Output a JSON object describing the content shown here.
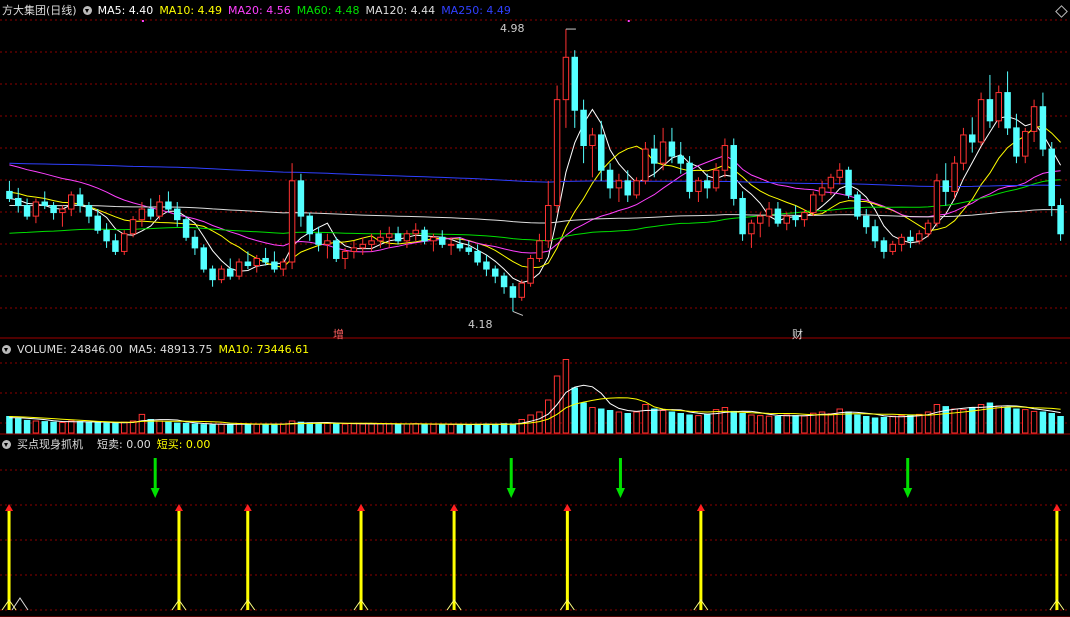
{
  "main_panel": {
    "title": "方大集团(日线)",
    "indicators": [
      {
        "label": "MA5: 4.40",
        "color": "#ffffff"
      },
      {
        "label": "MA10: 4.49",
        "color": "#ffff00"
      },
      {
        "label": "MA20: 4.56",
        "color": "#ff40ff"
      },
      {
        "label": "MA60: 4.48",
        "color": "#00e000"
      },
      {
        "label": "MA120: 4.44",
        "color": "#dddddd"
      },
      {
        "label": "MA250: 4.49",
        "color": "#3040ff"
      }
    ],
    "high_label": "4.98",
    "low_label": "4.18",
    "marker_left": "增",
    "marker_right": "财"
  },
  "volume_panel": {
    "label": "VOLUME: 24846.00",
    "ma5": "MA5: 48913.75",
    "ma10": "MA10: 73446.61"
  },
  "signal_panel": {
    "title": "买点现身抓机",
    "short_sell": "短卖: 0.00",
    "short_buy": "短买: 0.00"
  },
  "colors": {
    "up": "#ff3232",
    "down": "#54ffff",
    "grid": "#8b0000",
    "bg": "#000000"
  },
  "chart_data": {
    "type": "candlestick",
    "candles": [
      [
        4.52,
        4.55,
        4.49,
        4.5
      ],
      [
        4.5,
        4.53,
        4.46,
        4.48
      ],
      [
        4.48,
        4.5,
        4.44,
        4.45
      ],
      [
        4.45,
        4.5,
        4.43,
        4.49
      ],
      [
        4.49,
        4.52,
        4.47,
        4.48
      ],
      [
        4.48,
        4.49,
        4.44,
        4.46
      ],
      [
        4.46,
        4.48,
        4.42,
        4.47
      ],
      [
        4.47,
        4.52,
        4.45,
        4.51
      ],
      [
        4.51,
        4.53,
        4.46,
        4.48
      ],
      [
        4.48,
        4.49,
        4.43,
        4.45
      ],
      [
        4.45,
        4.47,
        4.4,
        4.41
      ],
      [
        4.41,
        4.43,
        4.36,
        4.38
      ],
      [
        4.38,
        4.4,
        4.34,
        4.35
      ],
      [
        4.35,
        4.41,
        4.34,
        4.4
      ],
      [
        4.4,
        4.45,
        4.39,
        4.44
      ],
      [
        4.44,
        4.49,
        4.42,
        4.47
      ],
      [
        4.47,
        4.5,
        4.44,
        4.45
      ],
      [
        4.45,
        4.51,
        4.44,
        4.49
      ],
      [
        4.49,
        4.52,
        4.46,
        4.47
      ],
      [
        4.47,
        4.49,
        4.42,
        4.44
      ],
      [
        4.44,
        4.45,
        4.38,
        4.39
      ],
      [
        4.39,
        4.41,
        4.34,
        4.36
      ],
      [
        4.36,
        4.37,
        4.29,
        4.3
      ],
      [
        4.3,
        4.31,
        4.25,
        4.27
      ],
      [
        4.27,
        4.31,
        4.26,
        4.3
      ],
      [
        4.3,
        4.33,
        4.27,
        4.28
      ],
      [
        4.28,
        4.33,
        4.27,
        4.32
      ],
      [
        4.32,
        4.35,
        4.3,
        4.31
      ],
      [
        4.31,
        4.34,
        4.29,
        4.33
      ],
      [
        4.33,
        4.36,
        4.31,
        4.32
      ],
      [
        4.32,
        4.35,
        4.29,
        4.3
      ],
      [
        4.3,
        4.33,
        4.28,
        4.32
      ],
      [
        4.32,
        4.6,
        4.3,
        4.55
      ],
      [
        4.55,
        4.57,
        4.42,
        4.45
      ],
      [
        4.45,
        4.46,
        4.38,
        4.4
      ],
      [
        4.4,
        4.42,
        4.35,
        4.37
      ],
      [
        4.37,
        4.4,
        4.33,
        4.38
      ],
      [
        4.38,
        4.39,
        4.32,
        4.33
      ],
      [
        4.33,
        4.36,
        4.3,
        4.35
      ],
      [
        4.35,
        4.38,
        4.33,
        4.36
      ],
      [
        4.36,
        4.39,
        4.34,
        4.37
      ],
      [
        4.37,
        4.4,
        4.35,
        4.38
      ],
      [
        4.38,
        4.41,
        4.36,
        4.39
      ],
      [
        4.39,
        4.42,
        4.36,
        4.4
      ],
      [
        4.4,
        4.42,
        4.37,
        4.38
      ],
      [
        4.38,
        4.41,
        4.36,
        4.4
      ],
      [
        4.4,
        4.43,
        4.38,
        4.41
      ],
      [
        4.41,
        4.42,
        4.37,
        4.38
      ],
      [
        4.38,
        4.4,
        4.35,
        4.39
      ],
      [
        4.39,
        4.41,
        4.36,
        4.37
      ],
      [
        4.37,
        4.39,
        4.34,
        4.37
      ],
      [
        4.37,
        4.39,
        4.35,
        4.36
      ],
      [
        4.36,
        4.38,
        4.34,
        4.35
      ],
      [
        4.35,
        4.37,
        4.31,
        4.32
      ],
      [
        4.32,
        4.34,
        4.28,
        4.3
      ],
      [
        4.3,
        4.31,
        4.26,
        4.28
      ],
      [
        4.28,
        4.29,
        4.23,
        4.25
      ],
      [
        4.25,
        4.26,
        4.18,
        4.22
      ],
      [
        4.22,
        4.27,
        4.21,
        4.26
      ],
      [
        4.26,
        4.34,
        4.25,
        4.33
      ],
      [
        4.33,
        4.4,
        4.32,
        4.38
      ],
      [
        4.38,
        4.55,
        4.36,
        4.48
      ],
      [
        4.48,
        4.82,
        4.46,
        4.78
      ],
      [
        4.78,
        4.98,
        4.7,
        4.9
      ],
      [
        4.9,
        4.92,
        4.7,
        4.75
      ],
      [
        4.75,
        4.78,
        4.6,
        4.65
      ],
      [
        4.65,
        4.7,
        4.56,
        4.68
      ],
      [
        4.68,
        4.72,
        4.55,
        4.58
      ],
      [
        4.58,
        4.6,
        4.5,
        4.53
      ],
      [
        4.53,
        4.57,
        4.49,
        4.55
      ],
      [
        4.55,
        4.58,
        4.49,
        4.51
      ],
      [
        4.51,
        4.56,
        4.5,
        4.55
      ],
      [
        4.55,
        4.66,
        4.54,
        4.64
      ],
      [
        4.64,
        4.68,
        4.56,
        4.6
      ],
      [
        4.6,
        4.7,
        4.58,
        4.66
      ],
      [
        4.66,
        4.7,
        4.6,
        4.62
      ],
      [
        4.62,
        4.66,
        4.57,
        4.6
      ],
      [
        4.6,
        4.62,
        4.5,
        4.52
      ],
      [
        4.52,
        4.56,
        4.49,
        4.55
      ],
      [
        4.55,
        4.57,
        4.5,
        4.53
      ],
      [
        4.53,
        4.6,
        4.52,
        4.58
      ],
      [
        4.58,
        4.67,
        4.56,
        4.65
      ],
      [
        4.65,
        4.67,
        4.48,
        4.5
      ],
      [
        4.5,
        4.52,
        4.38,
        4.4
      ],
      [
        4.4,
        4.44,
        4.36,
        4.43
      ],
      [
        4.43,
        4.46,
        4.39,
        4.45
      ],
      [
        4.45,
        4.49,
        4.42,
        4.47
      ],
      [
        4.47,
        4.49,
        4.42,
        4.43
      ],
      [
        4.43,
        4.46,
        4.41,
        4.45
      ],
      [
        4.45,
        4.48,
        4.42,
        4.44
      ],
      [
        4.44,
        4.47,
        4.42,
        4.46
      ],
      [
        4.46,
        4.52,
        4.45,
        4.51
      ],
      [
        4.51,
        4.55,
        4.49,
        4.53
      ],
      [
        4.53,
        4.57,
        4.51,
        4.56
      ],
      [
        4.56,
        4.6,
        4.54,
        4.58
      ],
      [
        4.58,
        4.59,
        4.5,
        4.51
      ],
      [
        4.51,
        4.52,
        4.44,
        4.45
      ],
      [
        4.45,
        4.47,
        4.4,
        4.42
      ],
      [
        4.42,
        4.44,
        4.36,
        4.38
      ],
      [
        4.38,
        4.39,
        4.33,
        4.35
      ],
      [
        4.35,
        4.38,
        4.34,
        4.37
      ],
      [
        4.37,
        4.4,
        4.35,
        4.39
      ],
      [
        4.39,
        4.41,
        4.36,
        4.38
      ],
      [
        4.38,
        4.41,
        4.37,
        4.4
      ],
      [
        4.4,
        4.44,
        4.39,
        4.43
      ],
      [
        4.43,
        4.57,
        4.42,
        4.55
      ],
      [
        4.55,
        4.6,
        4.48,
        4.52
      ],
      [
        4.52,
        4.62,
        4.5,
        4.6
      ],
      [
        4.6,
        4.7,
        4.58,
        4.68
      ],
      [
        4.68,
        4.73,
        4.63,
        4.66
      ],
      [
        4.66,
        4.8,
        4.65,
        4.78
      ],
      [
        4.78,
        4.85,
        4.7,
        4.72
      ],
      [
        4.72,
        4.82,
        4.7,
        4.8
      ],
      [
        4.8,
        4.86,
        4.68,
        4.7
      ],
      [
        4.7,
        4.74,
        4.6,
        4.62
      ],
      [
        4.62,
        4.7,
        4.6,
        4.69
      ],
      [
        4.69,
        4.78,
        4.66,
        4.76
      ],
      [
        4.76,
        4.8,
        4.62,
        4.64
      ],
      [
        4.64,
        4.66,
        4.45,
        4.48
      ],
      [
        4.48,
        4.5,
        4.38,
        4.4
      ]
    ],
    "volume": [
      55,
      48,
      42,
      40,
      38,
      36,
      35,
      40,
      38,
      36,
      34,
      33,
      32,
      36,
      40,
      62,
      45,
      40,
      36,
      33,
      32,
      30,
      28,
      27,
      30,
      29,
      31,
      30,
      29,
      30,
      29,
      30,
      40,
      36,
      34,
      33,
      32,
      31,
      30,
      31,
      30,
      30,
      31,
      30,
      29,
      30,
      31,
      30,
      29,
      29,
      28,
      28,
      28,
      29,
      30,
      29,
      31,
      30,
      45,
      60,
      70,
      110,
      190,
      245,
      150,
      100,
      85,
      80,
      75,
      70,
      65,
      70,
      95,
      80,
      75,
      70,
      65,
      60,
      58,
      62,
      78,
      85,
      72,
      65,
      60,
      58,
      56,
      55,
      60,
      58,
      57,
      66,
      70,
      64,
      80,
      70,
      60,
      55,
      50,
      52,
      56,
      58,
      60,
      62,
      70,
      95,
      88,
      80,
      78,
      85,
      95,
      100,
      90,
      85,
      80,
      78,
      72,
      70,
      65,
      55
    ],
    "buy_signals": [
      1,
      43,
      60,
      88,
      111,
      139,
      172,
      260
    ],
    "sell_signals": [
      37,
      125,
      152,
      223
    ]
  }
}
